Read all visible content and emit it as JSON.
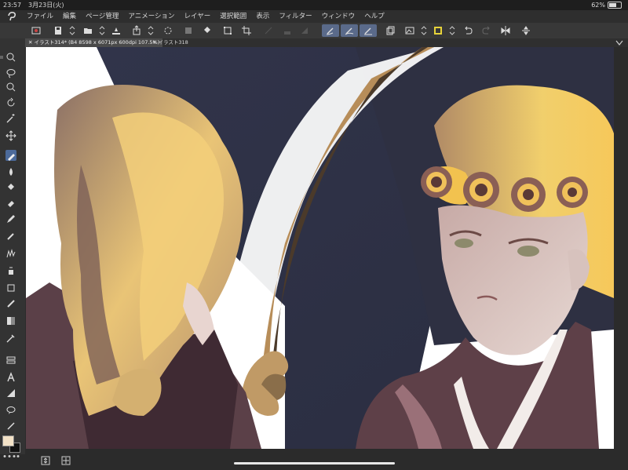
{
  "status": {
    "time": "23:57",
    "date": "3月23日(火)",
    "battery": "62%",
    "battery_level": 0.62
  },
  "menu": {
    "items": [
      "ファイル",
      "編集",
      "ページ管理",
      "アニメーション",
      "レイヤー",
      "選択範囲",
      "表示",
      "フィルター",
      "ウィンドウ",
      "ヘルプ"
    ]
  },
  "tabs": [
    {
      "label": "イラスト314* (B4 8598 x 6071px 600dpi 107.5%)",
      "active": true
    },
    {
      "label": "イラスト318",
      "active": false
    }
  ],
  "toolbar": {
    "icons": [
      "app-menu-icon",
      "save-icon",
      "open-icon",
      "export-icon",
      "share-icon",
      "transform-icon",
      "paint-bucket-icon",
      "canvas-icon",
      "lasso-icon",
      "fill-icon",
      "brush-pen-icon",
      "brush-mark-icon",
      "brush-smooth-icon",
      "layer-icon",
      "ruler-icon",
      "color-icon",
      "undo-icon",
      "redo-icon",
      "flip-icon",
      "align-icon"
    ]
  },
  "colors": {
    "accent": "#4c6a9a",
    "foreground": "#f3e2c7",
    "background": "#111111"
  }
}
